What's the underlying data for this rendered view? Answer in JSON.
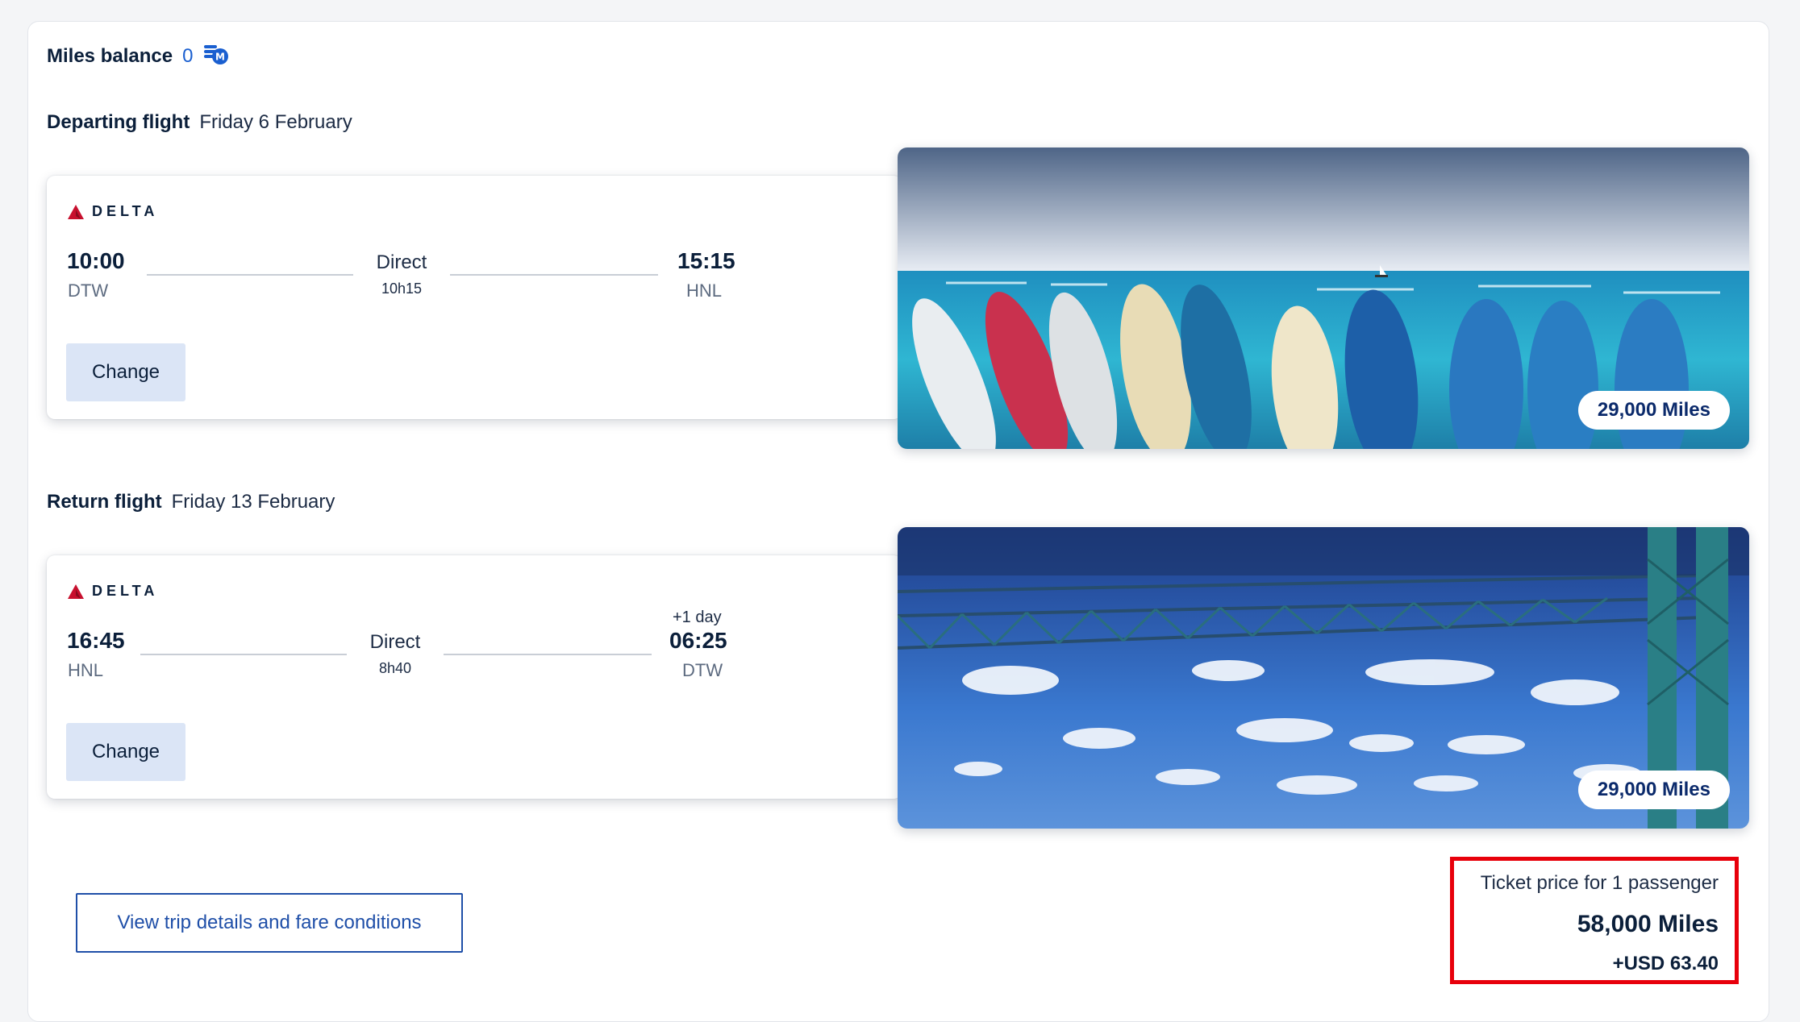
{
  "miles_balance": {
    "label": "Miles balance",
    "value": "0",
    "icon": "miles-coins-icon"
  },
  "departing": {
    "title": "Departing flight",
    "date": "Friday 6 February",
    "airline": "DELTA",
    "depart_time": "10:00",
    "depart_code": "DTW",
    "stops": "Direct",
    "duration": "10h15",
    "arrive_time": "15:15",
    "arrive_code": "HNL",
    "change_label": "Change",
    "miles_badge": "29,000 Miles",
    "image": "surfboards-beach-photo"
  },
  "return": {
    "title": "Return flight",
    "date": "Friday 13 February",
    "airline": "DELTA",
    "depart_time": "16:45",
    "depart_code": "HNL",
    "stops": "Direct",
    "duration": "8h40",
    "arrive_offset": "+1 day",
    "arrive_time": "06:25",
    "arrive_code": "DTW",
    "change_label": "Change",
    "miles_badge": "29,000 Miles",
    "image": "bridge-sky-photo"
  },
  "footer": {
    "details_button": "View trip details and fare conditions",
    "price_label": "Ticket price for 1 passenger",
    "price_miles": "58,000 Miles",
    "price_usd": "+USD 63.40"
  },
  "colors": {
    "accent": "#1f4fa8",
    "highlight_border": "#e8000b",
    "button_bg": "#dbe5f6",
    "delta_red": "#c8102e"
  }
}
